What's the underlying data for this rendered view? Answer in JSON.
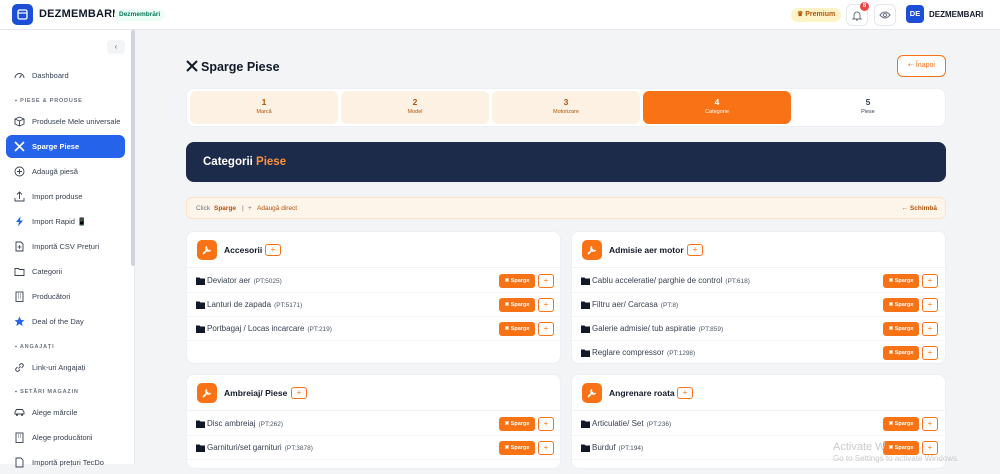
{
  "app": {
    "brand": "DEZMEMBARI",
    "brand_badge": "Dezmembrări",
    "premium": "Premium",
    "notifications_count": "8",
    "avatar_initials": "DE",
    "username": "DEZMEMBARI"
  },
  "sidebar": {
    "items": [
      {
        "label": "Dashboard",
        "icon": "dashboard-icon"
      },
      {
        "label": "Produsele Mele universale",
        "icon": "box-icon"
      },
      {
        "label": "Sparge Piese",
        "icon": "tools-icon",
        "active": true
      },
      {
        "label": "Adaugă piesă",
        "icon": "plus-circle-icon"
      },
      {
        "label": "Import produse",
        "icon": "upload-icon"
      },
      {
        "label": "Import Rapid 📱",
        "icon": "bolt-icon"
      },
      {
        "label": "Importă CSV Prețuri",
        "icon": "file-csv-icon"
      },
      {
        "label": "Categorii",
        "icon": "folder-icon"
      },
      {
        "label": "Producători",
        "icon": "building-icon"
      },
      {
        "label": "Deal of the Day",
        "icon": "star-icon"
      },
      {
        "label": "Link-uri Angajați",
        "icon": "link-icon"
      },
      {
        "label": "Alege mărcile",
        "icon": "car-icon"
      },
      {
        "label": "Alege producătorii",
        "icon": "building-icon"
      },
      {
        "label": "Importă prețuri TecDo",
        "icon": "document-icon"
      }
    ],
    "sections": [
      "PIESE & PRODUSE",
      "ANGAJAȚI",
      "SETĂRI MAGAZIN"
    ]
  },
  "page": {
    "title": "Sparge Piese",
    "back_label": "Înapoi",
    "steps": [
      {
        "num": "1",
        "name": "Marcă"
      },
      {
        "num": "2",
        "name": "Model"
      },
      {
        "num": "3",
        "name": "Motorizare"
      },
      {
        "num": "4",
        "name": "Categorie"
      },
      {
        "num": "5",
        "name": "Piese"
      }
    ],
    "banner_part1": "Categorii",
    "banner_part2": "Piese",
    "hint": {
      "click": "Click",
      "sparge": "Sparge",
      "sep": "|",
      "plus": "+",
      "add_direct": "Adaugă direct",
      "change": "← Schimbă"
    }
  },
  "categories": [
    {
      "title": "Accesorii",
      "rows": [
        {
          "name": "Deviator aer",
          "pt": "(PT:5025)"
        },
        {
          "name": "Lanturi de zapada",
          "pt": "(PT:5171)"
        },
        {
          "name": "Portbagaj / Locas incarcare",
          "pt": "(PT:219)"
        }
      ]
    },
    {
      "title": "Admisie aer motor",
      "rows": [
        {
          "name": "Cablu acceleratie/ parghie de control",
          "pt": "(PT:618)"
        },
        {
          "name": "Filtru aer/ Carcasa",
          "pt": "(PT:8)"
        },
        {
          "name": "Galerie admisie/ tub aspiratie",
          "pt": "(PT:859)"
        },
        {
          "name": "Reglare compressor",
          "pt": "(PT:1298)"
        }
      ]
    },
    {
      "title": "Ambreiaj/ Piese",
      "rows": [
        {
          "name": "Disc ambreiaj",
          "pt": "(PT:262)"
        },
        {
          "name": "Garnituri/set garnituri",
          "pt": "(PT:3878)"
        }
      ]
    },
    {
      "title": "Angrenare roata",
      "rows": [
        {
          "name": "Articulatie/ Set",
          "pt": "(PT:236)"
        },
        {
          "name": "Burduf",
          "pt": "(PT:194)"
        }
      ]
    }
  ],
  "buttons": {
    "sparge": "Sparge",
    "plus": "+"
  },
  "watermark": {
    "line1": "Activate W",
    "line2": "Go to Settings to activate Windows."
  }
}
